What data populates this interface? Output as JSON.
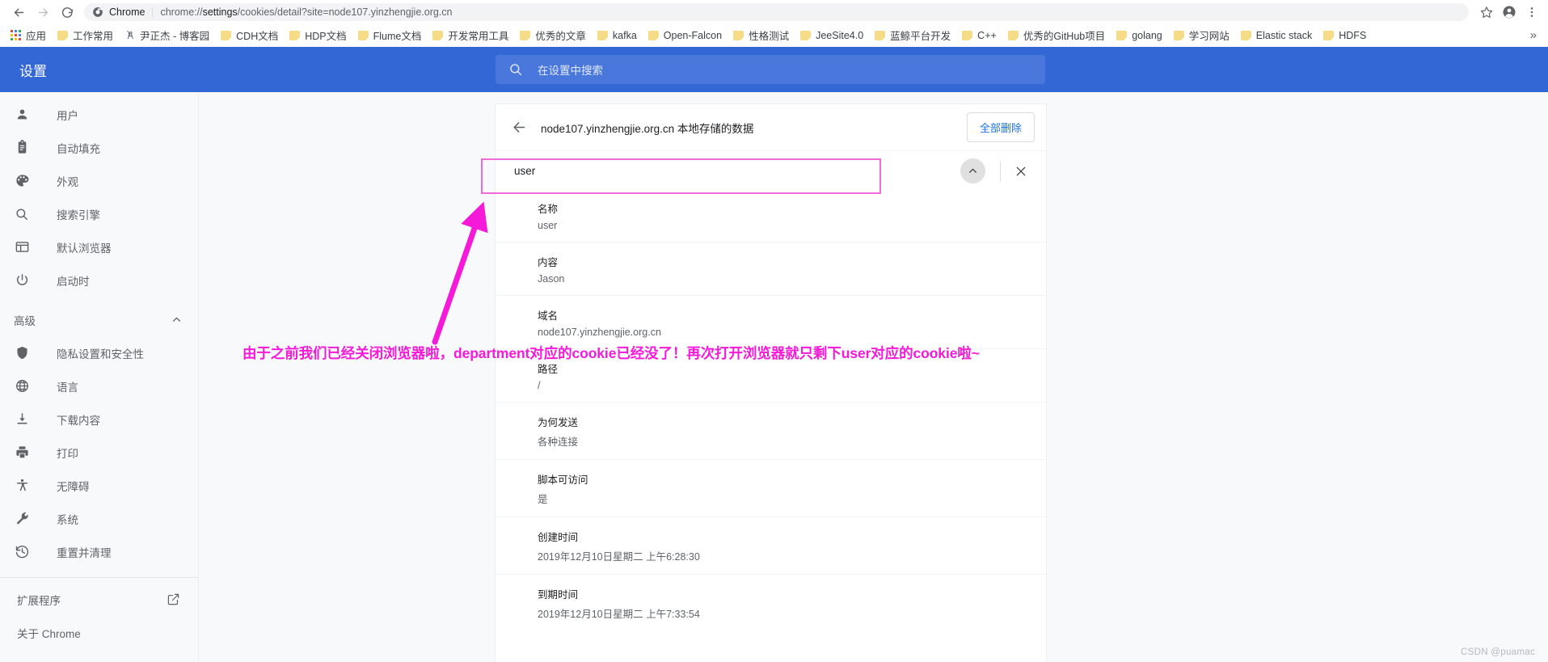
{
  "browser": {
    "nav": {
      "back_icon": "arrow-left-icon",
      "forward_icon": "arrow-right-icon",
      "reload_icon": "reload-icon"
    },
    "omnibox": {
      "security_icon": "chrome-logo-icon",
      "scheme_label": "Chrome",
      "url_prefix": "chrome://",
      "url_strong": "settings",
      "url_suffix": "/cookies/detail?site=node107.yinzhengjie.org.cn",
      "full_url": "chrome://settings/cookies/detail?site=node107.yinzhengjie.org.cn"
    },
    "actions": {
      "bookmark_star": "star-icon",
      "profile": "profile-avatar-icon",
      "menu": "three-dot-menu-icon"
    }
  },
  "bookmarks": {
    "apps_label": "应用",
    "overflow_label": "»",
    "items": [
      {
        "label": "工作常用",
        "icon": "folder-icon"
      },
      {
        "label": "尹正杰 - 博客园",
        "icon": "blog-icon"
      },
      {
        "label": "CDH文档",
        "icon": "folder-icon"
      },
      {
        "label": "HDP文档",
        "icon": "folder-icon"
      },
      {
        "label": "Flume文档",
        "icon": "folder-icon"
      },
      {
        "label": "开发常用工具",
        "icon": "folder-icon"
      },
      {
        "label": "优秀的文章",
        "icon": "folder-icon"
      },
      {
        "label": "kafka",
        "icon": "folder-icon"
      },
      {
        "label": "Open-Falcon",
        "icon": "folder-icon"
      },
      {
        "label": "性格测试",
        "icon": "folder-icon"
      },
      {
        "label": "JeeSite4.0",
        "icon": "folder-icon"
      },
      {
        "label": "蓝鲸平台开发",
        "icon": "folder-icon"
      },
      {
        "label": "C++",
        "icon": "folder-icon"
      },
      {
        "label": "优秀的GitHub项目",
        "icon": "folder-icon"
      },
      {
        "label": "golang",
        "icon": "folder-icon"
      },
      {
        "label": "学习网站",
        "icon": "folder-icon"
      },
      {
        "label": "Elastic stack",
        "icon": "folder-icon"
      },
      {
        "label": "HDFS",
        "icon": "folder-icon"
      }
    ]
  },
  "settings": {
    "brand": "设置",
    "search_placeholder": "在设置中搜索",
    "search_icon": "search-icon",
    "sidebar": {
      "items": [
        {
          "label": "用户",
          "icon": "person-icon"
        },
        {
          "label": "自动填充",
          "icon": "clipboard-icon"
        },
        {
          "label": "外观",
          "icon": "palette-icon"
        },
        {
          "label": "搜索引擎",
          "icon": "search-icon"
        },
        {
          "label": "默认浏览器",
          "icon": "browser-window-icon"
        },
        {
          "label": "启动时",
          "icon": "power-icon"
        }
      ],
      "advanced_label": "高级",
      "advanced_chevron": "chevron-up-icon",
      "advanced_items": [
        {
          "label": "隐私设置和安全性",
          "icon": "shield-icon"
        },
        {
          "label": "语言",
          "icon": "globe-icon"
        },
        {
          "label": "下载内容",
          "icon": "download-icon"
        },
        {
          "label": "打印",
          "icon": "printer-icon"
        },
        {
          "label": "无障碍",
          "icon": "accessibility-icon"
        },
        {
          "label": "系统",
          "icon": "wrench-icon"
        },
        {
          "label": "重置并清理",
          "icon": "history-restore-icon"
        }
      ],
      "links": [
        {
          "label": "扩展程序",
          "icon": "external-link-icon"
        },
        {
          "label": "关于 Chrome",
          "icon": ""
        }
      ]
    }
  },
  "cookie_page": {
    "back_icon": "arrow-left-icon",
    "title": "node107.yinzhengjie.org.cn 本地存储的数据",
    "delete_all_label": "全部删除",
    "search": {
      "value": "user",
      "collapse_icon": "chevron-up-icon",
      "close_icon": "close-icon"
    },
    "details": [
      {
        "label": "名称",
        "value": "user"
      },
      {
        "label": "内容",
        "value": "Jason"
      },
      {
        "label": "域名",
        "value": "node107.yinzhengjie.org.cn"
      },
      {
        "label": "路径",
        "value": "/"
      },
      {
        "label": "为何发送",
        "value": "各种连接"
      },
      {
        "label": "脚本可访问",
        "value": "是"
      },
      {
        "label": "创建时间",
        "value": "2019年12月10日星期二 上午6:28:30"
      },
      {
        "label": "到期时间",
        "value": "2019年12月10日星期二 上午7:33:54"
      }
    ]
  },
  "annotation": {
    "text": "由于之前我们已经关闭浏览器啦，department对应的cookie已经没了！再次打开浏览器就只剩下user对应的cookie啦~",
    "color": "#f519d8",
    "box_color": "#f06bd8",
    "arrow_icon": "arrow-pointer-icon"
  },
  "watermark": {
    "text": "CSDN @puamac"
  },
  "colors": {
    "settings_blue": "#3367d6",
    "page_bg": "#f8f9fa",
    "card_bg": "#ffffff",
    "link_blue": "#1a73e8",
    "annotation_magenta": "#f519d8"
  }
}
